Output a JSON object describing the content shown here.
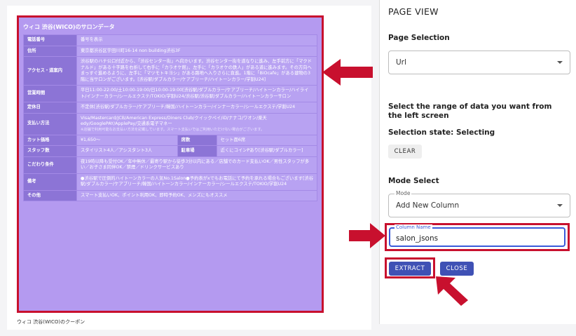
{
  "salon": {
    "title": "ウィコ 渋谷(WICO)のサロンデータ",
    "rows": {
      "phone": {
        "label": "電話番号",
        "value": "番号を表示"
      },
      "address": {
        "label": "住所",
        "value": "東京都渋谷区宇田川町16-14 non building渋谷3F"
      },
      "access": {
        "label": "アクセス・道案内",
        "value": "渋谷駅のハチ公口付近から、「渋谷センター街」へ向かいます。渋谷センター街を道なりに進み、左手前方に「マクドナルド」がある十字路を右折して右手に「カラオケ館」、左手に「カラオケの鉄人」がある道に進みます。その方向へまっすぐ進めるように、左手に「マツモトキヨシ」がある路地へ入りさらに直進。1階に「BiOcafe」がある建物の3階に当サロンがございます。[渋谷駅/ダブルカラー/ケアブリーチ/ハイトーンカラー/学割U24]"
      },
      "hours": {
        "label": "営業時間",
        "value": "平日11:00-22:00/土10:00-19:00/日10:00-19:00[渋谷駅/ダブルカラー/ケアブリーチ/ハイトーンカラー/ハイライト/インナーカラー/シールエクステ/TOKIO/学割U24/渋谷駅/渋谷駅/ダブルカラー/ハイトーンカラーサロン"
      },
      "holiday": {
        "label": "定休日",
        "value": "不定休[渋谷駅/ダブルカラー/ケアブリーチ/韓国/ハイトーンカラー/インナーカラー/シールエクステ/学割U24"
      },
      "payment": {
        "label": "支払い方法",
        "value": "Visa/Mastercard/JCB/American Express/Diners Club/クイックペイ/iD/ナナコ/ワオン/楽天edy/GooglePAY/ApplePay/交通系電子マネー",
        "note": "※店舗で利用可能なお支払い方法を記載しています。スマート支払いではご利用いただけない場合がございます。"
      },
      "cut_price": {
        "label": "カット価格",
        "value": "¥1,650〜",
        "label2": "席数",
        "value2": "セット面6席"
      },
      "staff": {
        "label": "スタッフ数",
        "value": "スタイリスト4人／アシスタント3人",
        "label2": "駐車場",
        "value2": "近くにコインPあり[渋谷駅/ダブルカラー]"
      },
      "features": {
        "label": "こだわり条件",
        "value": "夜19時以降も受付OK／年中無休／最寄り駅から徒歩3分以内にある／店舗でのカード支払いOK／男性スタッフが多い／お子さま同伴OK／禁煙／ドリンクサービスあり"
      },
      "remarks": {
        "label": "備考",
        "value": "●渋谷駅で圧倒的ハイトーンカラーの人気No.1Salon●予約表がxでもお電話にて予約を承れる場合もございます[渋谷駅/ダブルカラー/ケアブリーチ/韓国/ハイトーンカラー/インナーカラー/シールエクステ/TOKIO/学割U24"
      },
      "other": {
        "label": "その他",
        "value": "スマート支払いOK、ポイント利用OK、即時予約OK、メンズにもオススメ"
      }
    }
  },
  "coupon_heading": "ウィコ 渋谷(WICO)のクーポン",
  "panel": {
    "title": "PAGE VIEW",
    "page_selection_label": "Page Selection",
    "page_selection_value": "Url",
    "instruction": "Select the range of data you want from the left screen",
    "selection_state": "Selection state: Selecting",
    "clear_label": "CLEAR",
    "mode_select_label": "Mode Select",
    "mode_legend": "Mode",
    "mode_value": "Add New Column",
    "column_name_legend": "Column Name",
    "column_name_value": "salon_jsons",
    "extract_label": "EXTRACT",
    "close_label": "CLOSE"
  },
  "colors": {
    "highlight_red": "#c8102e",
    "primary_blue": "#3f51b5",
    "salon_purple": "#b49af0"
  }
}
